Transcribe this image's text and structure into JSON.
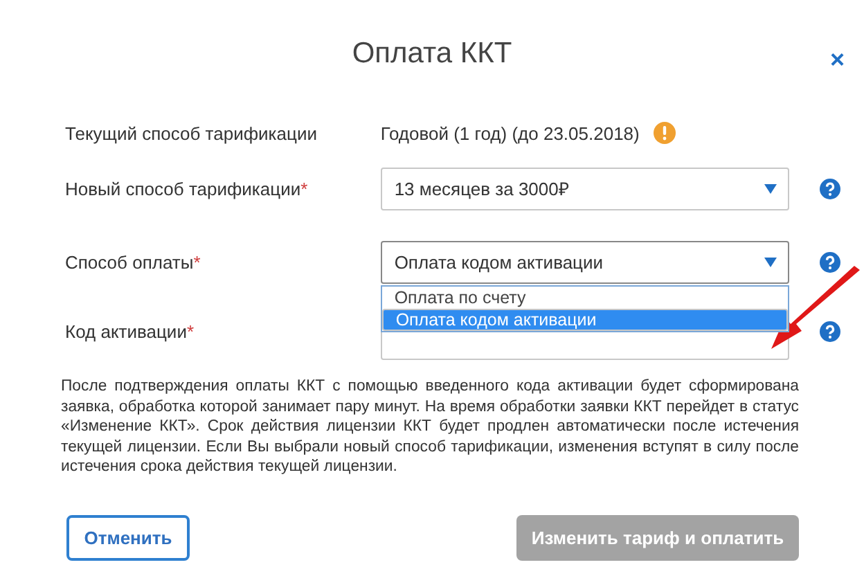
{
  "dialog": {
    "title": "Оплата ККТ",
    "close": "×"
  },
  "fields": [
    {
      "kind": "text",
      "label": "Текущий способ тарификации",
      "required": false,
      "value": "Годовой (1 год) (до 23.05.2018)",
      "warning": true,
      "help": false
    },
    {
      "kind": "select",
      "label": "Новый способ тарификации",
      "required": true,
      "value": "13 месяцев за 3000₽",
      "help": true,
      "expanded": false
    },
    {
      "kind": "select",
      "label": "Способ оплаты",
      "required": true,
      "value": "Оплата кодом активации",
      "help": true,
      "expanded": true,
      "options": [
        {
          "label": "Оплата по счету",
          "selected": false
        },
        {
          "label": "Оплата кодом активации",
          "selected": true
        }
      ]
    },
    {
      "kind": "input",
      "label": "Код активации",
      "required": true,
      "help": true
    }
  ],
  "required_mark": "*",
  "note": "После подтверждения оплаты ККТ с помощью введенного кода активации будет сформирована заявка, обработка которой занимает пару минут. На время обработки заявки ККТ перейдет в статус «Изменение ККТ». Срок действия лицензии ККТ будет продлен автоматически после истечения текущей лицензии. Если Вы выбрали новый способ тарификации, изменения вступят в силу после истечения срока действия текущей лицензии.",
  "buttons": [
    {
      "kind": "secondary",
      "label": "Отменить",
      "disabled": false
    },
    {
      "kind": "primary",
      "label": "Изменить тариф и оплатить",
      "disabled": true
    }
  ]
}
